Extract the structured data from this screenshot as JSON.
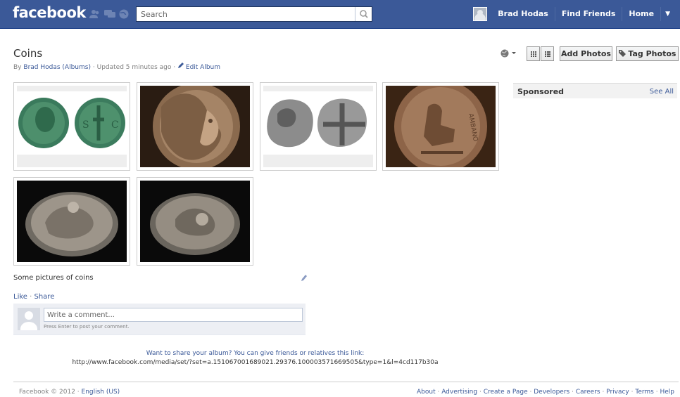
{
  "topbar": {
    "logo": "facebook",
    "search_placeholder": "Search",
    "user_name": "Brad Hodas",
    "find_friends": "Find Friends",
    "home": "Home",
    "jewels": [
      "friend-requests-icon",
      "messages-icon",
      "notifications-icon"
    ]
  },
  "album": {
    "title": "Coins",
    "by_prefix": "By",
    "owner": "Brad Hodas",
    "albums_link": "(Albums)",
    "updated": "Updated 5 minutes ago",
    "edit_label": "Edit Album",
    "description": "Some pictures of coins"
  },
  "toolbar": {
    "add_photos": "Add Photos",
    "tag_photos": "Tag Photos"
  },
  "photos": [
    {
      "name": "green bronze coin pair"
    },
    {
      "name": "head of Heracles coin"
    },
    {
      "name": "silver cross coins pair"
    },
    {
      "name": "seated Zeus coin"
    },
    {
      "name": "worn silver coin 1"
    },
    {
      "name": "worn silver coin 2"
    }
  ],
  "sponsored": {
    "title": "Sponsored",
    "see_all": "See All"
  },
  "actions": {
    "like": "Like",
    "share": "Share",
    "separator": " · "
  },
  "comment": {
    "placeholder": "Write a comment...",
    "hint": "Press Enter to post your comment."
  },
  "share": {
    "message": "Want to share your album? You can give friends or relatives this link:",
    "url": "http://www.facebook.com/media/set/?set=a.151067001689021.29376.100003571669505&type=1&l=4cd117b30a"
  },
  "footer": {
    "copyright": "Facebook © 2012 ·",
    "language": "English (US)",
    "links": [
      "About",
      "Advertising",
      "Create a Page",
      "Developers",
      "Careers",
      "Privacy",
      "Terms",
      "Help"
    ]
  },
  "colors": {
    "brand_blue": "#3b5998",
    "link_blue": "#3b5998"
  }
}
